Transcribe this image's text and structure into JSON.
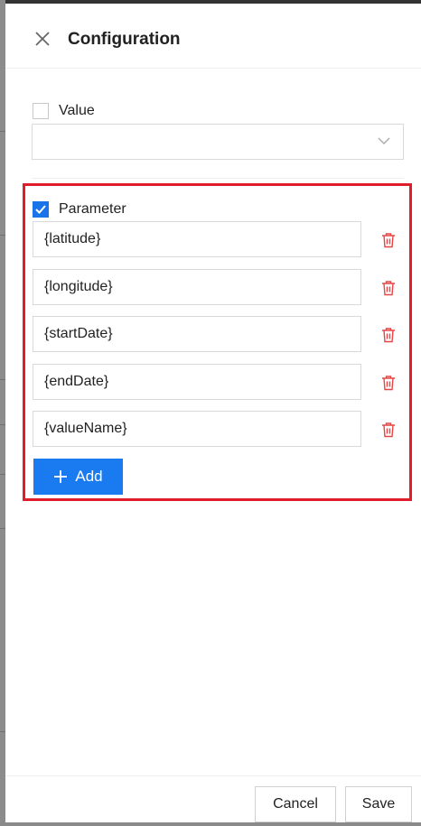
{
  "dialog": {
    "title": "Configuration"
  },
  "value_section": {
    "checkbox_label": "Value",
    "checked": false,
    "select_value": ""
  },
  "parameter_section": {
    "checkbox_label": "Parameter",
    "checked": true,
    "params": [
      "{latitude}",
      "{longitude}",
      "{startDate}",
      "{endDate}",
      "{valueName}"
    ],
    "add_label": "Add"
  },
  "footer": {
    "cancel_label": "Cancel",
    "save_label": "Save"
  },
  "colors": {
    "accent": "#1a7bf0",
    "highlight_border": "#e01d2b",
    "delete_icon": "#e64545"
  },
  "icons": {
    "close": "close-icon",
    "chevron": "chevron-down-icon",
    "delete": "trash-icon",
    "add": "plus-icon",
    "check": "checkmark-icon"
  }
}
